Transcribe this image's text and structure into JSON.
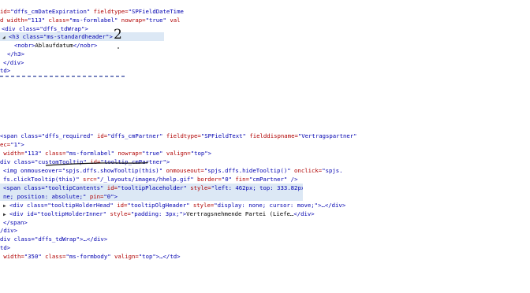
{
  "top_block": {
    "l1": {
      "a": "id=",
      "b": "\"dffs_cmDateExpiration\"",
      "c": " fieldtype=",
      "d": "\"SPFieldDateTime"
    },
    "l2": {
      "a": "d width=",
      "b": "\"113\"",
      "c": " class=",
      "d": "\"ms-formlabel\"",
      "e": " nowrap=",
      "f": "\"true\"",
      "g": " val"
    },
    "l3": {
      "a": "<div class=",
      "b": "\"dffs_tdWrap\"",
      "c": ">"
    },
    "l4": {
      "a": "<h3 class=",
      "b": "\"ms-standardheader\"",
      "c": ">"
    },
    "l5": {
      "a": "<nobr>",
      "b": "Ablaufdatum",
      "c": "</nobr>"
    },
    "l6": "</h3>",
    "l7": "</div>",
    "l8": "td>",
    "annotation": "2"
  },
  "bottom_block": {
    "l1": {
      "a": "<span class=",
      "b": "\"dffs_required\"",
      "c": " id=",
      "d": "\"dffs_cmPartner\"",
      "e": " fieldtype=",
      "f": "\"SPFieldText\"",
      "g": " fielddispname=",
      "h": "\"Vertragspartner\""
    },
    "l2": {
      "a": "ec=",
      "b": "\"1\"",
      "c": ">"
    },
    "l3": {
      "a": " width=",
      "b": "\"113\"",
      "c": " class=",
      "d": "\"ms-formlabel\"",
      "e": " nowrap=",
      "f": "\"true\"",
      "g": " valign=",
      "h": "\"top\"",
      "i": ">"
    },
    "l4": {
      "a": "div class=",
      "b": "\"customTooltip\"",
      "c": " id=",
      "d": "\"tooltip_cmPartner\"",
      "e": ">"
    },
    "l5": {
      "a": "<img onmouseover=",
      "b": "\"spjs.dffs.showTooltip(this)\"",
      "c": " onmouseout=",
      "d": "\"spjs.dffs.hideTooltip()\"",
      "e": " onclick=",
      "f": "\"spjs."
    },
    "l6": {
      "a": "fs.clickTooltip(this)\"",
      "b": " src=",
      "c": "\"/_layouts/images/hhelp.gif\"",
      "d": " border=",
      "e": "\"0\"",
      "f": " fin=",
      "g": "\"cmPartner\"",
      "h": " />"
    },
    "l7": {
      "a": "<span class=",
      "b": "\"tooltipContents\"",
      "c": " id=",
      "d": "\"tooltipPlaceholder\"",
      "e": " style=",
      "f": "\"left: 462px; top: 333.82px; display:"
    },
    "l8": {
      "a": "ne; position: absolute;\"",
      "b": " pin=",
      "c": "\"0\"",
      "d": ">"
    },
    "l9": {
      "a": "<div class=",
      "b": "\"tooltipHolderHead\"",
      "c": " id=",
      "d": "\"tooltipOlgHeader\"",
      "e": " style=",
      "f": "\"display: none; cursor: move;\"",
      "g": ">…</div>"
    },
    "l10": {
      "a": "<div id=",
      "b": "\"tooltipHolderInner\"",
      "c": " style=",
      "d": "\"padding: 3px;\"",
      "e": ">",
      "f": "Vertragsnehmende Partei (Liefe…",
      "g": "</div>"
    },
    "l11": "</span>",
    "l12": "/div>",
    "l13": {
      "a": "div class=",
      "b": "\"dffs_tdWrap\"",
      "c": ">…</div>"
    },
    "l14": "td>",
    "l15": {
      "a": " width=",
      "b": "\"350\"",
      "c": " class=",
      "d": "\"ms-formbody\"",
      "e": " valign=",
      "f": "\"top\"",
      "g": ">…</td>"
    }
  },
  "colors": {
    "tag": "#0000b0",
    "attribute": "#b00000",
    "highlight": "#dce8f5",
    "annotation_ink": "#111111"
  }
}
